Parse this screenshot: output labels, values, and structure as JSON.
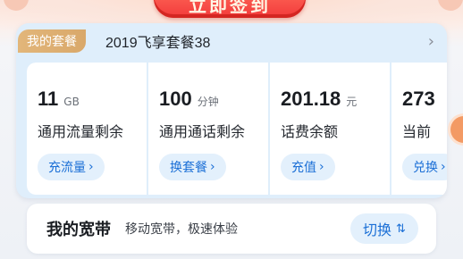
{
  "banner": {
    "signin_label": "立即签到"
  },
  "package": {
    "tag_label": "我的套餐",
    "name": "2019飞享套餐38",
    "chevron_icon": "chevron-right-icon",
    "tiles": [
      {
        "value": "11",
        "unit": "GB",
        "label": "通用流量剩余",
        "button": "充流量"
      },
      {
        "value": "100",
        "unit": "分钟",
        "label": "通用通话剩余",
        "button": "换套餐"
      },
      {
        "value": "201.18",
        "unit": "元",
        "label": "话费余额",
        "button": "充值"
      },
      {
        "value": "273",
        "unit": "",
        "label": "当前",
        "button": "兑换"
      }
    ]
  },
  "broadband": {
    "title": "我的宽带",
    "subtitle": "移动宽带，极速体验",
    "button": "切换",
    "switch_icon": "switch-arrows-icon"
  },
  "colors": {
    "accent_blue": "#1b6fd6",
    "tag_gold": "#d9a86a",
    "signin_red": "#f23a3a"
  }
}
